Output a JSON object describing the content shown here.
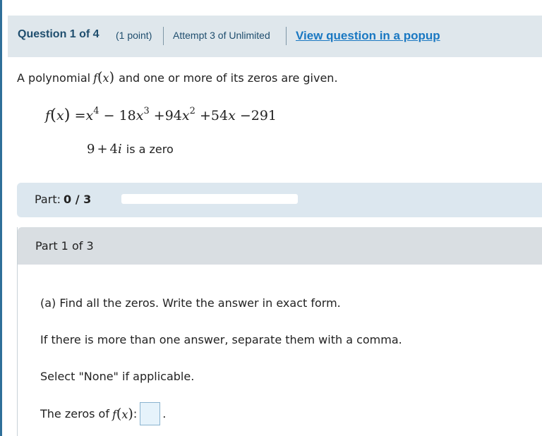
{
  "header": {
    "question_label": "Question 1 of 4",
    "points": "(1 point)",
    "attempt": "Attempt 3 of Unlimited",
    "popup_link": "View question in a popup"
  },
  "problem": {
    "intro_before": "A polynomial",
    "intro_func": "f",
    "intro_var": "x",
    "intro_after": "and one or more of its zeros are given.",
    "polynomial": {
      "lhs_func": "f",
      "lhs_var": "x",
      "equals": "=",
      "t1_base": "x",
      "t1_exp": "4",
      "op1": "−",
      "t2_coef": "18",
      "t2_base": "x",
      "t2_exp": "3",
      "op2": "+",
      "t3_coef": "94",
      "t3_base": "x",
      "t3_exp": "2",
      "op3": "+",
      "t4_coef": "54",
      "t4_base": "x",
      "op4": "−",
      "constant": "291"
    },
    "zero": {
      "real": "9",
      "plus": "+",
      "imag_coef": "4",
      "imag_unit": "i",
      "text": "is a zero"
    }
  },
  "part_progress": {
    "label": "Part:",
    "score": "0 / 3",
    "completed": 0,
    "total": 3,
    "fill_color": "#3a8fd0"
  },
  "part1": {
    "title": "Part 1 of 3",
    "instruction_a": "(a) Find all the zeros. Write the answer in exact form.",
    "instruction_b": "If there is more than one answer, separate them with a comma.",
    "instruction_c": "Select \"None\" if applicable.",
    "answer_prefix": "The zeros of",
    "answer_func": "f",
    "answer_var": "x",
    "answer_colon": ":",
    "answer_value": "",
    "answer_suffix": "."
  },
  "colors": {
    "header_bg": "#dfe7ec",
    "link": "#1a78c2",
    "title_text": "#1f4e6e"
  }
}
